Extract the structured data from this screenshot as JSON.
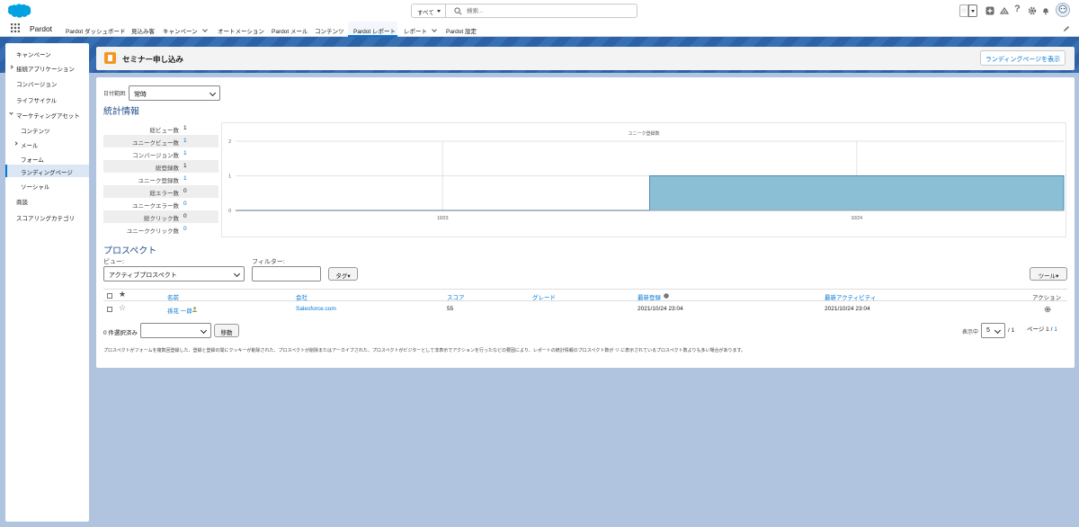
{
  "search": {
    "scope": "すべて",
    "placeholder": "検索..."
  },
  "app_name": "Pardot",
  "nav": [
    {
      "label": "Pardot ダッシュボード",
      "active": false,
      "menu": false
    },
    {
      "label": "見込み客",
      "active": false,
      "menu": false
    },
    {
      "label": "キャンペーン",
      "active": false,
      "menu": true
    },
    {
      "label": "オートメーション",
      "active": false,
      "menu": false
    },
    {
      "label": "Pardot メール",
      "active": false,
      "menu": false
    },
    {
      "label": "コンテンツ",
      "active": false,
      "menu": false
    },
    {
      "label": "Pardot レポート",
      "active": true,
      "menu": false
    },
    {
      "label": "レポート",
      "active": false,
      "menu": true
    },
    {
      "label": "Pardot 設定",
      "active": false,
      "menu": false
    }
  ],
  "sidebar": {
    "items": [
      {
        "label": "キャンペーン"
      },
      {
        "label": "接続アプリケーション"
      },
      {
        "label": "コンバージョン"
      },
      {
        "label": "ライフサイクル"
      },
      {
        "label": "マーケティングアセット"
      },
      {
        "label": "コンテンツ"
      },
      {
        "label": "メール"
      },
      {
        "label": "フォーム"
      },
      {
        "label": "ランディングページ"
      },
      {
        "label": "ソーシャル"
      },
      {
        "label": "商談"
      },
      {
        "label": "スコアリングカテゴリ"
      }
    ]
  },
  "header": {
    "title": "セミナー申し込み",
    "button_label": "ランディングページを表示"
  },
  "filters": {
    "date_range_label": "日付範囲:",
    "date_range_value": "常時"
  },
  "stats": {
    "title": "統計情報",
    "rows": [
      {
        "label": "総ビュー数",
        "value": "1",
        "link": false
      },
      {
        "label": "ユニークビュー数",
        "value": "1",
        "link": true
      },
      {
        "label": "コンバージョン数",
        "value": "1",
        "link": true
      },
      {
        "label": "総登録数",
        "value": "1",
        "link": false
      },
      {
        "label": "ユニーク登録数",
        "value": "1",
        "link": true
      },
      {
        "label": "総エラー数",
        "value": "0",
        "link": false
      },
      {
        "label": "ユニークエラー数",
        "value": "0",
        "link": true
      },
      {
        "label": "総クリック数",
        "value": "0",
        "link": false
      },
      {
        "label": "ユニーククリック数",
        "value": "0",
        "link": true
      }
    ]
  },
  "chart_data": {
    "type": "area",
    "title": "ユニーク登録数",
    "categories": [
      "10/23",
      "10/24"
    ],
    "x": [
      "10/23",
      "10/24"
    ],
    "values": [
      0,
      1
    ],
    "ylim": [
      0,
      2
    ],
    "yticks": [
      "0",
      "1",
      "2"
    ],
    "xlabel": "",
    "ylabel": "",
    "grid": true,
    "fill_color": "#8bbfd6",
    "line_color": "#2f77a8"
  },
  "prospects": {
    "title": "プロスペクト",
    "view_label": "ビュー:",
    "view_value": "アクティブプロスペクト",
    "filter_label": "フィルター:",
    "filter_value": "",
    "tag_button": "タグ▾",
    "tools_button": "ツール▾",
    "columns": [
      "名前",
      "会社",
      "スコア",
      "グレード",
      "最新登録",
      "最新アクティビティ",
      "アクション"
    ],
    "rows": [
      {
        "name": "孫花 一郎",
        "company": "Salesforce.com",
        "score": "55",
        "grade": "",
        "last_registration": "2021/10/24 23:04",
        "last_activity": "2021/10/24 23:04"
      }
    ],
    "selected_label": "0 件選択済み",
    "move_button": "移動",
    "per_page_label": "表示中",
    "per_page_value": "5",
    "per_page_suffix": "/ 1",
    "page_label": "ページ 1 /",
    "page_total": "1",
    "footnote": "プロスペクトがフォームを複数回登録した、登録と登録の間にクッキーが削除された、プロスペクトが削除またはアーカイブされた、プロスペクトがビジターとして非表示でアクションを行ったなどの要因により、レポートの統計情報のプロスペクト数が リ に表示されているプロスペクト数よりも多い場合があります。"
  },
  "colors": {
    "accent": "#0176d3",
    "header_icon": "#f49721",
    "brand_blue": "#2d63a6"
  }
}
